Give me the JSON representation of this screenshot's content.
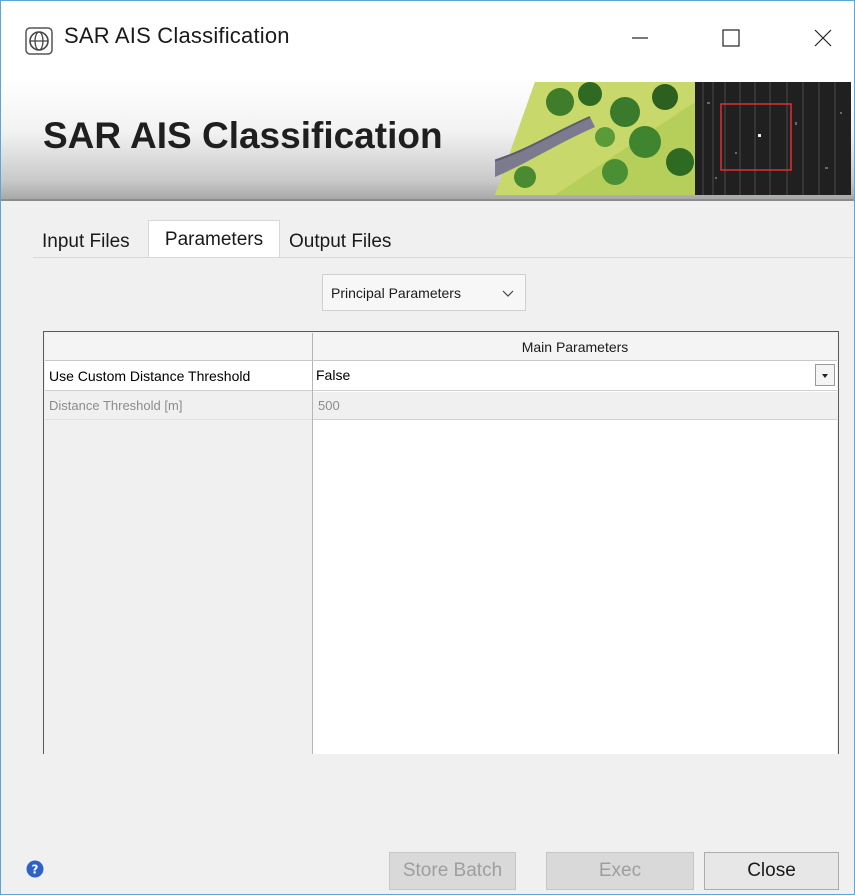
{
  "window": {
    "title": "SAR AIS Classification",
    "controls": {
      "minimize": "minimize",
      "maximize": "maximize",
      "close": "close"
    }
  },
  "banner": {
    "title": "SAR AIS Classification"
  },
  "tabs": [
    {
      "label": "Input Files",
      "active": false
    },
    {
      "label": "Parameters",
      "active": true
    },
    {
      "label": "Output Files",
      "active": false
    }
  ],
  "parameter_group": {
    "selected": "Principal Parameters"
  },
  "table": {
    "header": "Main Parameters",
    "rows": [
      {
        "label": "Use Custom Distance Threshold",
        "value": "False",
        "enabled": true
      },
      {
        "label": "Distance Threshold [m]",
        "value": "500",
        "enabled": false
      }
    ]
  },
  "buttons": {
    "store_batch": "Store Batch",
    "exec": "Exec",
    "close": "Close"
  },
  "icons": {
    "app": "app-icon",
    "help": "help-icon",
    "dropdown": "chevron-down-icon"
  },
  "colors": {
    "accent": "#2f62c7",
    "window_border": "#5aa6d8",
    "sar_box": "#e03030"
  }
}
